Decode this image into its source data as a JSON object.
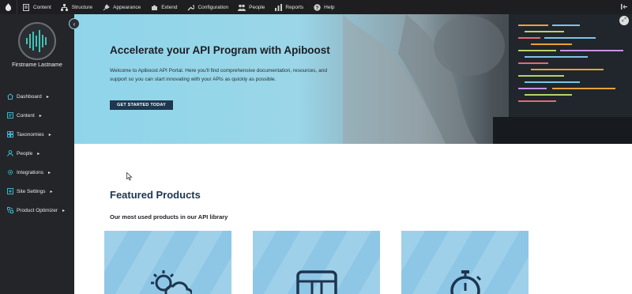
{
  "toolbar": {
    "items": [
      {
        "label": "Content",
        "icon": "content-icon"
      },
      {
        "label": "Structure",
        "icon": "structure-icon"
      },
      {
        "label": "Appearance",
        "icon": "appearance-icon"
      },
      {
        "label": "Extend",
        "icon": "extend-icon"
      },
      {
        "label": "Configuration",
        "icon": "configuration-icon"
      },
      {
        "label": "People",
        "icon": "people-icon"
      },
      {
        "label": "Reports",
        "icon": "reports-icon"
      },
      {
        "label": "Help",
        "icon": "help-icon"
      }
    ]
  },
  "sidebar": {
    "user_name": "Firstname Lastname",
    "items": [
      {
        "label": "Dashboard",
        "icon": "home-icon"
      },
      {
        "label": "Content",
        "icon": "content-icon"
      },
      {
        "label": "Taxonomies",
        "icon": "taxonomy-icon"
      },
      {
        "label": "People",
        "icon": "person-icon"
      },
      {
        "label": "Integrations",
        "icon": "gear-icon"
      },
      {
        "label": "Site Settings",
        "icon": "settings-icon"
      },
      {
        "label": "Product Optimizer",
        "icon": "optimizer-icon"
      }
    ]
  },
  "hero": {
    "title": "Accelerate your API Program with Apiboost",
    "text": "Welcome to Apiboost API Portal. Here you'll find comprehensive documentation, resources, and support so you can start innovating with your APIs as quickly as possible.",
    "button_label": "GET STARTED TODAY"
  },
  "main": {
    "featured_title": "Featured Products",
    "featured_subtitle": "Our most used products in our API library",
    "cards": [
      {
        "icon": "weather-icon"
      },
      {
        "icon": "storage-icon"
      },
      {
        "icon": "stopwatch-icon"
      }
    ]
  },
  "colors": {
    "toolbar_bg": "#1e1e21",
    "sidebar_bg": "#232529",
    "accent": "#3fb3c9",
    "heading": "#1d3550",
    "button_bg": "#1f3750",
    "card_bg": "#9fd0ea"
  }
}
